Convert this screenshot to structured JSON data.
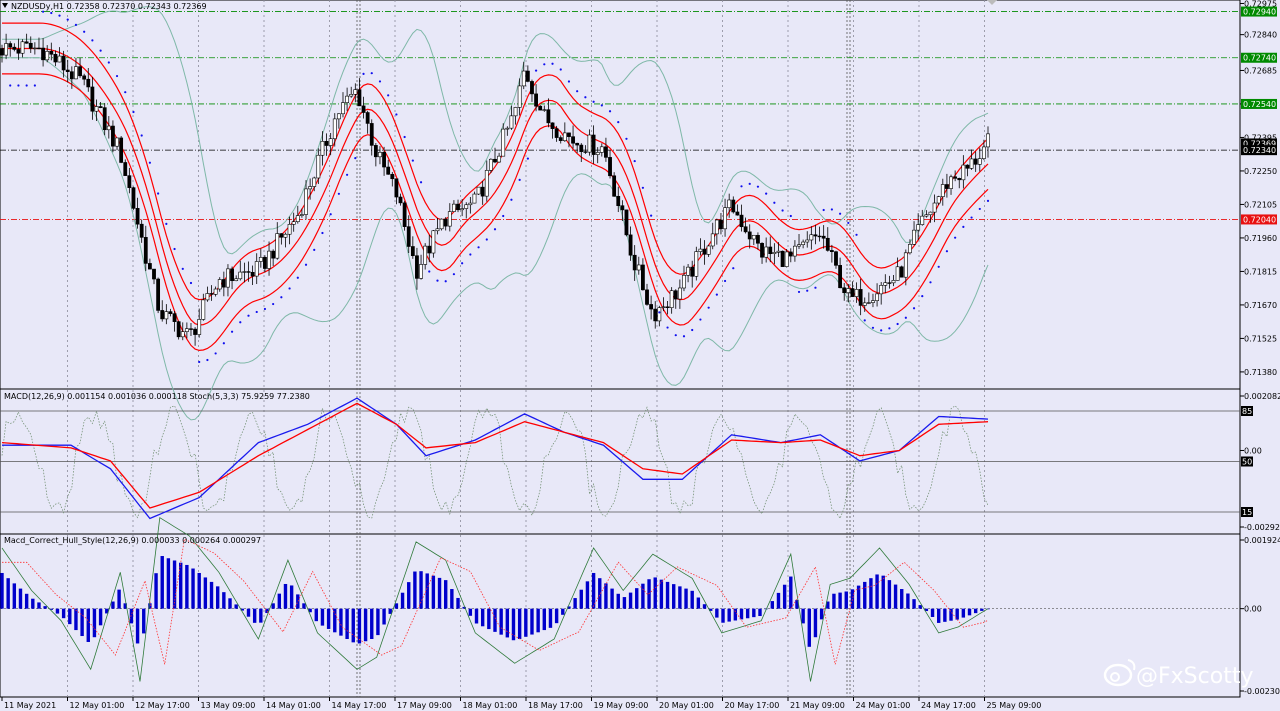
{
  "window": {
    "symbol_title": "NZDUSDy,H1  0.72358 0.72370 0.72343 0.72369",
    "title_menu_icon": "down-triangle-icon",
    "top_marker_icon": "chevron-down-icon"
  },
  "watermark": {
    "icon": "weibo-icon",
    "text": "@FxScotty"
  },
  "colors": {
    "background": "#e8e8f8",
    "candle": "#000000",
    "bollinger": "#7fb8a8",
    "envelope": "#ff0000",
    "sar": "#1010ee",
    "macd_main": "#1a1aee",
    "macd_signal": "#ff0000",
    "histogram": "#0000cc",
    "level_green": "#008a00",
    "level_red": "#e81010",
    "current_price": "#000000"
  },
  "chart_data": [
    {
      "type": "candlestick",
      "panel": "main",
      "symbol": "NZDUSDy",
      "timeframe": "H1",
      "ohlc_current": {
        "open": 0.72358,
        "high": 0.7237,
        "low": 0.72343,
        "close": 0.72369
      },
      "x_ticks": [
        "11 May 2021",
        "12 May 01:00",
        "12 May 17:00",
        "13 May 09:00",
        "14 May 01:00",
        "14 May 17:00",
        "17 May 09:00",
        "18 May 01:00",
        "18 May 17:00",
        "19 May 09:00",
        "20 May 01:00",
        "20 May 17:00",
        "21 May 09:00",
        "24 May 01:00",
        "24 May 17:00",
        "25 May 09:00"
      ],
      "y_ticks": [
        "0.72975",
        "0.72840",
        "0.72685",
        "0.72540",
        "0.72395",
        "0.72250",
        "0.72105",
        "0.71960",
        "0.71815",
        "0.71670",
        "0.71525",
        "0.71380"
      ],
      "ylim": [
        0.71306,
        0.7299
      ],
      "price_labels": [
        {
          "value": 0.7294,
          "text": "0.72940",
          "kind": "green"
        },
        {
          "value": 0.7274,
          "text": "0.72740",
          "kind": "green"
        },
        {
          "value": 0.7254,
          "text": "0.72540",
          "kind": "green"
        },
        {
          "value": 0.72369,
          "text": "0.72369",
          "kind": "current"
        },
        {
          "value": 0.7234,
          "text": "0.72340",
          "kind": "current"
        },
        {
          "value": 0.7204,
          "text": "0.72040",
          "kind": "red"
        }
      ],
      "trend_x": [
        0.0,
        0.04,
        0.08,
        0.12,
        0.16,
        0.19,
        0.22,
        0.26,
        0.3,
        0.34,
        0.36,
        0.38,
        0.4,
        0.42,
        0.45,
        0.48,
        0.52,
        0.53,
        0.55,
        0.58,
        0.61,
        0.64,
        0.66,
        0.69,
        0.72,
        0.74,
        0.77,
        0.8,
        0.83,
        0.85,
        0.86,
        0.88,
        0.91,
        0.93,
        0.96,
        0.98,
        1.0
      ],
      "trend_close": [
        0.7278,
        0.7278,
        0.7264,
        0.7233,
        0.7164,
        0.7153,
        0.7178,
        0.7182,
        0.7206,
        0.725,
        0.726,
        0.7232,
        0.7215,
        0.7182,
        0.7205,
        0.7211,
        0.725,
        0.7269,
        0.7248,
        0.7238,
        0.7235,
        0.7187,
        0.7163,
        0.7175,
        0.7198,
        0.721,
        0.719,
        0.7187,
        0.7198,
        0.7178,
        0.7169,
        0.7172,
        0.718,
        0.72,
        0.7221,
        0.7226,
        0.72369
      ]
    },
    {
      "type": "line",
      "panel": "macd_stoch",
      "title": "MACD(12,26,9) 0.001154 0.001036 0.000118  Stoch(5,3,3) 75.9259 77.2380",
      "y_ticks": [
        "0.002082",
        "0.00",
        "-0.002925"
      ],
      "levels": [
        {
          "value": 85,
          "text": "85"
        },
        {
          "value": 50,
          "text": "50"
        },
        {
          "value": 15,
          "text": "15"
        }
      ],
      "macd_x": [
        0.0,
        0.07,
        0.11,
        0.15,
        0.2,
        0.26,
        0.31,
        0.36,
        0.4,
        0.43,
        0.48,
        0.53,
        0.57,
        0.61,
        0.65,
        0.69,
        0.74,
        0.79,
        0.83,
        0.87,
        0.91,
        0.95,
        1.0
      ],
      "macd_series": [
        {
          "name": "MACD",
          "values": [
            0.0002,
            0.0002,
            -0.0007,
            -0.0026,
            -0.0018,
            0.0003,
            0.001,
            0.002,
            0.001,
            -0.0002,
            0.0004,
            0.0014,
            0.0007,
            0.0002,
            -0.0011,
            -0.0011,
            0.0006,
            0.0003,
            0.0006,
            -0.0004,
            0.0,
            0.0013,
            0.0012
          ]
        },
        {
          "name": "Signal",
          "values": [
            0.0003,
            0.0001,
            -0.0004,
            -0.0022,
            -0.0016,
            -0.0002,
            0.0008,
            0.0018,
            0.001,
            0.0001,
            0.0003,
            0.0011,
            0.0007,
            0.0003,
            -0.0007,
            -0.0009,
            0.0004,
            0.0003,
            0.0004,
            -0.0002,
            0.0,
            0.001,
            0.0011
          ]
        }
      ]
    },
    {
      "type": "bar",
      "panel": "macd_hull",
      "title": "Macd_Correct_Hull_Style(12,26,9) 0.000033 0.000264 0.000297",
      "y_ticks": [
        "0.001924",
        "0.00",
        "-0.002307"
      ],
      "histogram_x": [
        0.0,
        0.03,
        0.06,
        0.09,
        0.12,
        0.14,
        0.16,
        0.19,
        0.22,
        0.26,
        0.29,
        0.32,
        0.36,
        0.38,
        0.42,
        0.45,
        0.48,
        0.52,
        0.56,
        0.6,
        0.63,
        0.66,
        0.7,
        0.73,
        0.77,
        0.8,
        0.82,
        0.84,
        0.86,
        0.89,
        0.92,
        0.95,
        0.97,
        1.0
      ],
      "histogram_values": [
        0.001,
        0.0003,
        -0.0002,
        -0.001,
        0.0006,
        -0.0012,
        0.0015,
        0.0012,
        0.0006,
        -0.0005,
        0.0008,
        -0.0004,
        -0.001,
        -0.0008,
        0.0011,
        0.0008,
        -0.0004,
        -0.0009,
        -0.0005,
        0.001,
        0.0003,
        0.0009,
        0.0005,
        -0.0004,
        -0.0002,
        0.0009,
        -0.0012,
        0.0004,
        0.0005,
        0.001,
        0.0004,
        -0.0004,
        -0.0003,
        0.0
      ]
    }
  ]
}
